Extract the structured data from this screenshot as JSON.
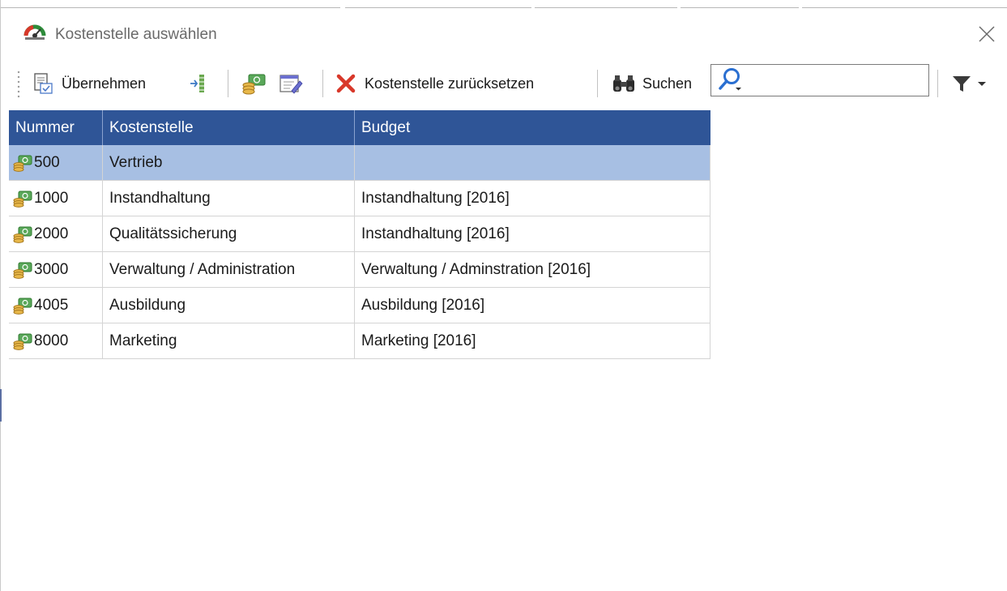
{
  "window": {
    "title": "Kostenstelle auswählen"
  },
  "toolbar": {
    "apply_label": "Übernehmen",
    "reset_label": "Kostenstelle zurücksetzen",
    "search_label": "Suchen",
    "search_value": ""
  },
  "table": {
    "columns": [
      "Nummer",
      "Kostenstelle",
      "Budget"
    ],
    "rows": [
      {
        "nummer": "500",
        "kostenstelle": "Vertrieb",
        "budget": ""
      },
      {
        "nummer": "1000",
        "kostenstelle": "Instandhaltung",
        "budget": "Instandhaltung [2016]"
      },
      {
        "nummer": "2000",
        "kostenstelle": "Qualitätssicherung",
        "budget": "Instandhaltung [2016]"
      },
      {
        "nummer": "3000",
        "kostenstelle": "Verwaltung / Administration",
        "budget": "Verwaltung / Adminstration [2016]"
      },
      {
        "nummer": "4005",
        "kostenstelle": "Ausbildung",
        "budget": "Ausbildung [2016]"
      },
      {
        "nummer": "8000",
        "kostenstelle": "Marketing",
        "budget": "Marketing [2016]"
      }
    ],
    "selected_row": 0
  },
  "icons": {
    "app": "cost-center-app-icon",
    "apply": "apply-document-icon",
    "columns": "column-chooser-icon",
    "cost_center": "cost-center-icon",
    "edit_form": "edit-form-icon",
    "reset": "red-x-icon",
    "search": "binoculars-icon",
    "filter": "filter-funnel-icon"
  },
  "colors": {
    "header_bg": "#2f5597",
    "selected_row_bg": "#a7bfe3",
    "reset_icon": "#d8382a"
  }
}
